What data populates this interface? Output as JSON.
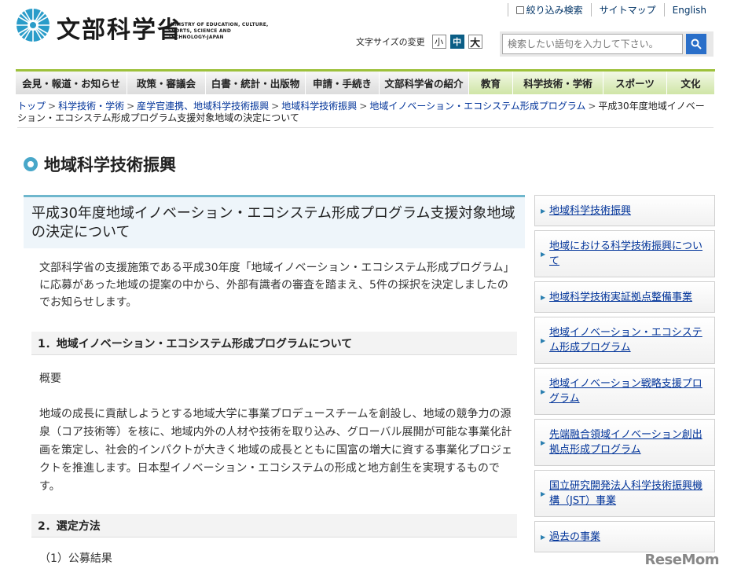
{
  "header": {
    "logo_jp": "文部科学省",
    "logo_en": "MINISTRY OF EDUCATION, CULTURE, SPORTS, SCIENCE AND TECHNOLOGY-JAPAN",
    "util_links": [
      "絞り込み検索",
      "サイトマップ",
      "English"
    ],
    "font_size_label": "文字サイズの変更",
    "font_sizes": [
      "小",
      "中",
      "大"
    ],
    "search_placeholder": "検索したい語句を入力して下さい。"
  },
  "nav": [
    "会見・報道・お知らせ",
    "政策・審議会",
    "白書・統計・出版物",
    "申請・手続き",
    "文部科学省の紹介",
    "教育",
    "科学技術・学術",
    "スポーツ",
    "文化"
  ],
  "breadcrumb": {
    "links": [
      "トップ",
      "科学技術・学術",
      "産学官連携、地域科学技術振興",
      "地域科学技術振興",
      "地域イノベーション・エコシステム形成プログラム"
    ],
    "current": "平成30年度地域イノベーション・エコシステム形成プログラム支援対象地域の決定について"
  },
  "page_heading": "地域科学技術振興",
  "article": {
    "title": "平成30年度地域イノベーション・エコシステム形成プログラム支援対象地域の決定について",
    "intro": "文部科学省の支援施策である平成30年度「地域イノベーション・エコシステム形成プログラム」に応募があった地域の提案の中から、外部有識者の審査を踏まえ、5件の採択を決定しましたのでお知らせします。",
    "section1": "1．地域イノベーション・エコシステム形成プログラムについて",
    "overview_label": "概要",
    "overview_text": "地域の成長に貢献しようとする地域大学に事業プロデュースチームを創設し、地域の競争力の源泉（コア技術等）を核に、地域内外の人材や技術を取り込み、グローバル展開が可能な事業化計画を策定し、社会的インパクトが大きく地域の成長とともに国富の増大に資する事業化プロジェクトを推進します。日本型イノベーション・エコシステムの形成と地方創生を実現するものです。",
    "section2": "2．選定方法",
    "sub1": "（1）公募結果"
  },
  "sidebar": [
    "地域科学技術振興",
    "地域における科学技術振興について",
    "地域科学技術実証拠点整備事業",
    "地域イノベーション・エコシステム形成プログラム",
    "地域イノベーション戦略支援プログラム",
    "先端融合領域イノベーション創出拠点形成プログラム",
    "国立研究開発法人科学技術振興機構（JST）事業",
    "過去の事業"
  ],
  "watermark": "ReseMom"
}
